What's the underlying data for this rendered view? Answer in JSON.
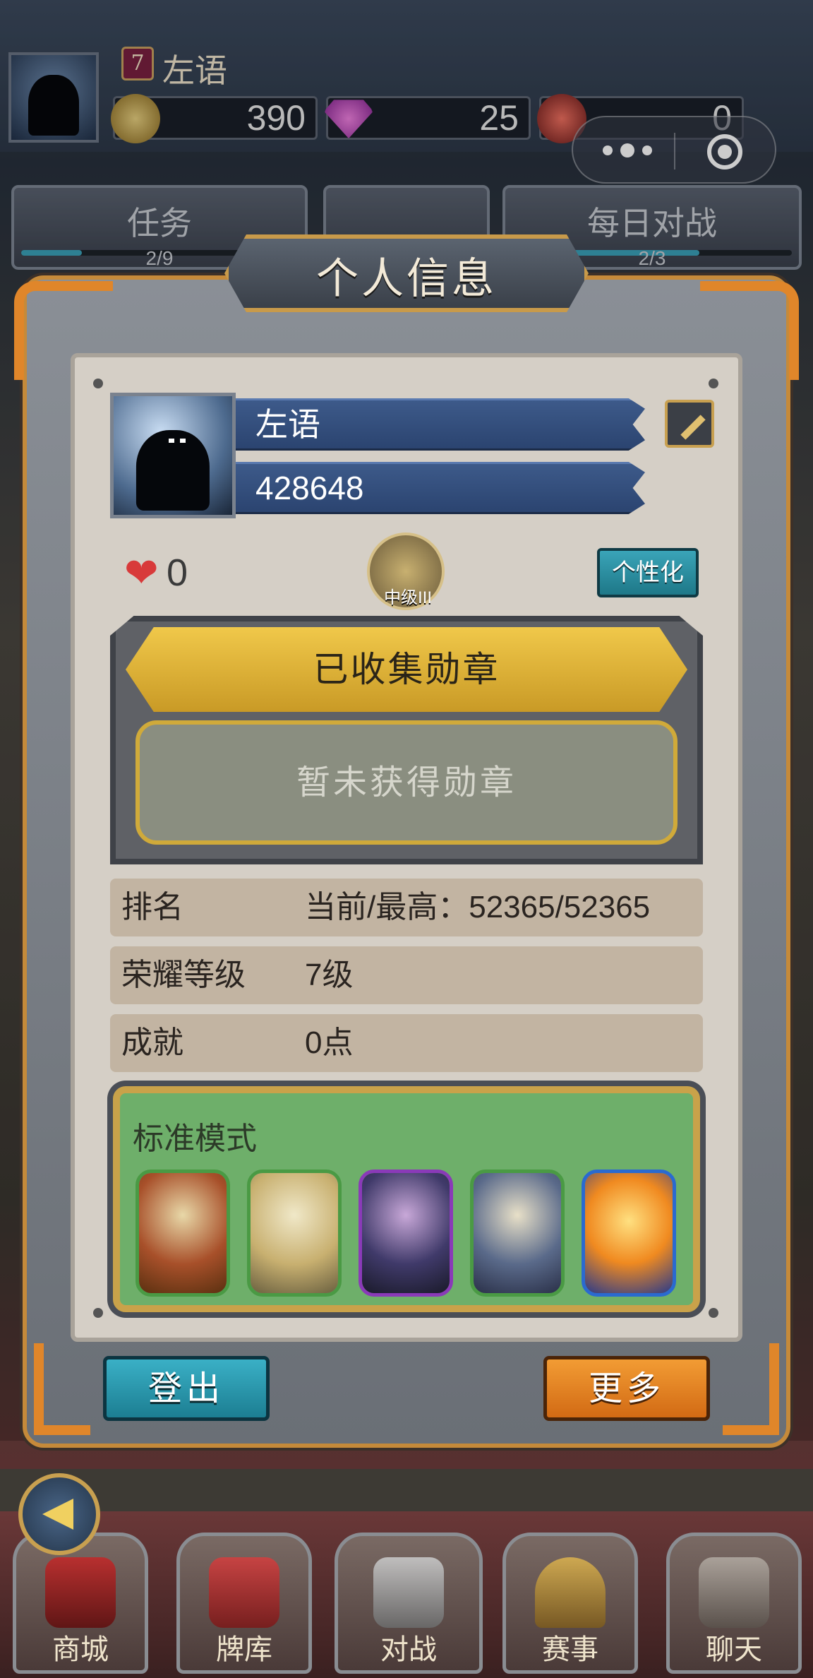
{
  "top_bar": {
    "player_level": "7",
    "player_name": "左语",
    "coins": "390",
    "gems": "25",
    "potions": "0"
  },
  "background_tabs": [
    {
      "label": "任务",
      "progress": "2/9",
      "fraction": 0.22
    },
    {
      "label": "每日对战",
      "progress": "2/3",
      "fraction": 0.67
    }
  ],
  "modal": {
    "title": "个人信息",
    "profile": {
      "name": "左语",
      "id": "428648",
      "likes": "0",
      "rank_badge": "中级III",
      "customize_label": "个性化"
    },
    "medals": {
      "title": "已收集勋章",
      "empty_text": "暂未获得勋章"
    },
    "stats": [
      {
        "key": "排名",
        "value": "当前/最高：52365/52365"
      },
      {
        "key": "荣耀等级",
        "value": "7级"
      },
      {
        "key": "成就",
        "value": "0点"
      }
    ],
    "mode": {
      "title": "标准模式",
      "cards": [
        {
          "icon": "red-armored-warrior",
          "frame": "#4a9a44"
        },
        {
          "icon": "golden-knight",
          "frame": "#4a9a44"
        },
        {
          "icon": "caped-general",
          "frame": "#8a3ab8"
        },
        {
          "icon": "staff-monk",
          "frame": "#4a9a44"
        },
        {
          "icon": "phoenix",
          "frame": "#2a6ad0"
        }
      ]
    },
    "logout_label": "登出",
    "more_label": "更多"
  },
  "bottom_nav": [
    {
      "label": "商城",
      "icon": "shop-chest-icon"
    },
    {
      "label": "牌库",
      "icon": "cards-icon"
    },
    {
      "label": "对战",
      "icon": "crossed-swords-icon"
    },
    {
      "label": "赛事",
      "icon": "trophy-icon"
    },
    {
      "label": "聊天",
      "icon": "handshake-icon"
    }
  ],
  "colors": {
    "accent_orange": "#e0862a",
    "gold": "#d0aa3a",
    "name_bar_blue": "#2b4470",
    "teal_button": "#1e7888",
    "orange_button": "#d26a14",
    "mode_green": "#6eaf6a"
  }
}
